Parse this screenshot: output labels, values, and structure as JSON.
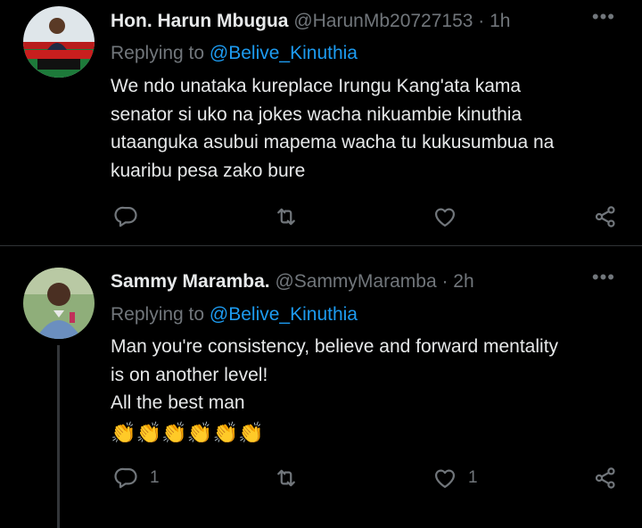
{
  "tweets": [
    {
      "display_name": "Hon. Harun Mbugua",
      "handle": "@HarunMb20727153",
      "separator": " · ",
      "time": "1h",
      "more": "•••",
      "replying_prefix": "Replying to ",
      "replying_handle": "@Belive_Kinuthia",
      "lines": [
        "We ndo unataka kureplace Irungu Kang'ata kama",
        "senator si uko na jokes wacha nikuambie kinuthia",
        "utaanguka asubui mapema wacha tu kukusumbua na",
        "kuaribu pesa zako bure"
      ],
      "reply_count": "",
      "retweet_count": "",
      "like_count": ""
    },
    {
      "display_name": "Sammy Maramba.",
      "handle": "@SammyMaramba",
      "separator": " · ",
      "time": "2h",
      "more": "•••",
      "replying_prefix": "Replying to ",
      "replying_handle": "@Belive_Kinuthia",
      "lines": [
        "Man you're consistency, believe and forward mentality",
        "is on another level!",
        "All the best man"
      ],
      "emojis": "👏👏👏👏👏👏",
      "reply_count": "1",
      "retweet_count": "",
      "like_count": "1"
    }
  ],
  "colors": {
    "background": "#000000",
    "text": "#e7e9ea",
    "muted": "#71767b",
    "link": "#1d9bf0",
    "divider": "#2f3336"
  },
  "icons": [
    "reply-icon",
    "retweet-icon",
    "like-icon",
    "share-icon",
    "more-icon"
  ]
}
